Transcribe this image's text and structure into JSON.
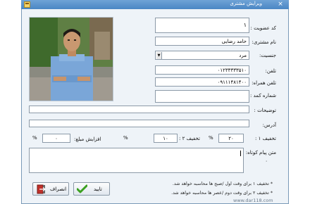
{
  "window": {
    "title": "ویرایش مشتری",
    "close_glyph": "×"
  },
  "form": {
    "member_code": {
      "label": "کد عضویت :",
      "value": "۱"
    },
    "customer_name": {
      "label": "نام مشتری:",
      "value": "حامد رضایی"
    },
    "gender": {
      "label": "جنسیت:",
      "value": "مرد",
      "arrow": "▼"
    },
    "phone": {
      "label": "تلفن:",
      "value": "۰۱۲۳۳۳۳۳۵۱۰"
    },
    "mobile": {
      "label": "تلفن همراه:",
      "value": "۰۹۱۱۱۴۸۱۴۰۰"
    },
    "card_number": {
      "label": "شماره کمد :",
      "value": ""
    },
    "description": {
      "label": "توضیحات :",
      "value": ""
    },
    "address": {
      "label": "آدرس:",
      "value": ""
    },
    "discount1": {
      "label": "تخفیف ۱ :",
      "value": "۲۰",
      "unit": "%"
    },
    "discount2": {
      "label": "تخفیف ۲ :",
      "value": "۱۰",
      "unit": "%"
    },
    "increase": {
      "label": "افزایش مبلغ:",
      "value": "۰",
      "unit": "%"
    },
    "sms": {
      "label": "متن پیام کوتاه:",
      "value": "۰"
    }
  },
  "notes": [
    "* تخفیف ۱ برای وقت اول /صبح ها محاسبه خواهد شد.",
    "* تخفیف ۲ برای وقت دوم /عصر ها محاسبه خواهد شد."
  ],
  "buttons": {
    "confirm": {
      "label": "تایید",
      "icon": "checkmark-icon"
    },
    "cancel": {
      "label": "انصراف",
      "icon": "exit-door-icon"
    }
  },
  "watermark": "www.dar118.com",
  "colors": {
    "titlebar": "#4a86c4",
    "window_bg": "#eef3f8",
    "confirm_check": "#3aa020",
    "cancel_icon": "#c0302a"
  }
}
